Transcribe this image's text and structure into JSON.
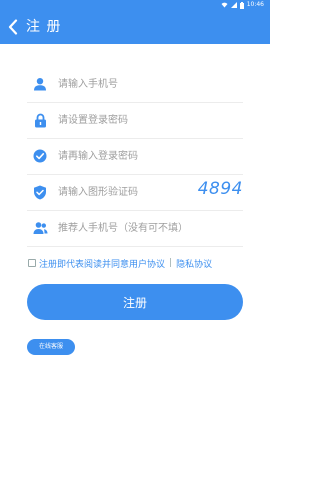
{
  "status_bar": {
    "time": "10:46",
    "icons": [
      "wifi-icon",
      "signal-icon",
      "battery-icon"
    ]
  },
  "header": {
    "title": "注 册",
    "back_icon": "chevron-left-icon"
  },
  "form": {
    "phone": {
      "placeholder": "请输入手机号",
      "value": "",
      "icon": "user-icon"
    },
    "password": {
      "placeholder": "请设置登录密码",
      "value": "",
      "icon": "lock-icon"
    },
    "confirm_password": {
      "placeholder": "请再输入登录密码",
      "value": "",
      "icon": "check-circle-icon"
    },
    "captcha": {
      "placeholder": "请输入图形验证码",
      "value": "",
      "icon": "shield-check-icon",
      "code": "4894"
    },
    "referrer": {
      "placeholder": "推荐人手机号（没有可不填）",
      "value": "",
      "icon": "users-icon"
    }
  },
  "agreement": {
    "checked": false,
    "user_agreement_label": "注册即代表阅读并同意用户协议",
    "separator": "|",
    "privacy_label": "隐私协议"
  },
  "register_button": "注册",
  "service_button": "在线客服",
  "colors": {
    "primary": "#3d8fef",
    "text_placeholder": "#9e9e9e",
    "divider": "#ececec",
    "background": "#ffffff"
  }
}
